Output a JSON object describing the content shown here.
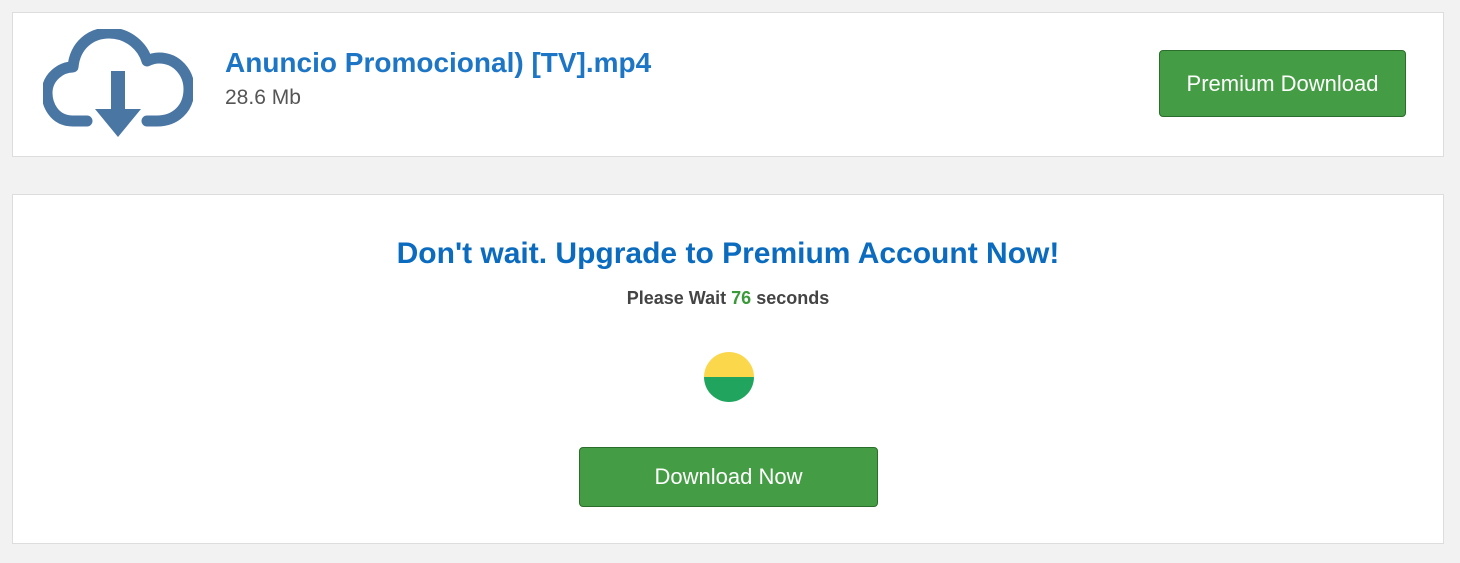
{
  "file": {
    "icon": "cloud-download-icon",
    "name": "Anuncio Promocional) [TV].mp4",
    "size": "28.6 Mb"
  },
  "buttons": {
    "premium_download": "Premium Download",
    "download_now": "Download Now"
  },
  "wait": {
    "headline": "Don't wait. Upgrade to Premium Account Now!",
    "prefix": "Please Wait",
    "seconds": "76",
    "suffix": "seconds",
    "spinner_icon": "loading-spinner-icon"
  },
  "colors": {
    "page_bg": "#f2f2f2",
    "link_blue": "#1d75c6",
    "headline_blue": "#0a6bbf",
    "button_green": "#449d44",
    "countdown_green": "#3a9a3a",
    "icon_blue": "#4a76a4",
    "spinner_yellow": "#fbd74c",
    "spinner_green": "#21a55e"
  }
}
